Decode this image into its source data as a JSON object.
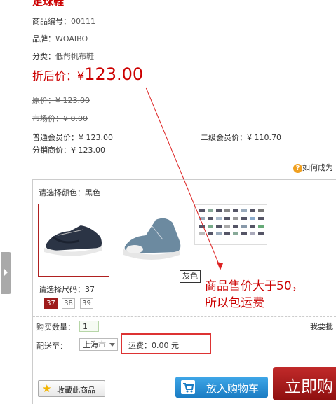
{
  "product": {
    "title": "足球鞋",
    "code_label": "商品编号：",
    "code_value": "00111",
    "brand_label": "品牌：",
    "brand_value": "WOAIBO",
    "category_label": "分类：",
    "category_value": "低帮帆布鞋"
  },
  "prices": {
    "discount_label": "折后价：",
    "currency": "¥",
    "discount_value": "123.00",
    "original": "原价：¥ 123.00",
    "market": "市场价：¥ 0.00",
    "regular_member": "普通会员价：¥ 123.00",
    "second_member": "二级会员价：¥ 110.70",
    "distributor": "分销商价：¥ 123.00"
  },
  "help_link": "如何成为",
  "color": {
    "label": "请选择颜色：",
    "selected": "黑色",
    "tooltip": "灰色"
  },
  "size": {
    "label": "请选择尺码：",
    "selected": "37",
    "options": [
      "37",
      "38",
      "39"
    ]
  },
  "quantity": {
    "label": "购买数量：",
    "value": "1",
    "right_text": "我要批"
  },
  "delivery": {
    "label": "配送至：",
    "city": "上海市",
    "shipping_fee": "运费：0.00 元"
  },
  "annotation": {
    "line1": "商品售价大于50，",
    "line2": "所以包运费"
  },
  "buttons": {
    "favorite": "收藏此商品",
    "add_to_cart": "放入购物车",
    "buy_now": "立即购"
  },
  "colors": {
    "accent_red": "#cc0000",
    "cart_blue": "#1a7cc3",
    "buy_red": "#a81818"
  }
}
